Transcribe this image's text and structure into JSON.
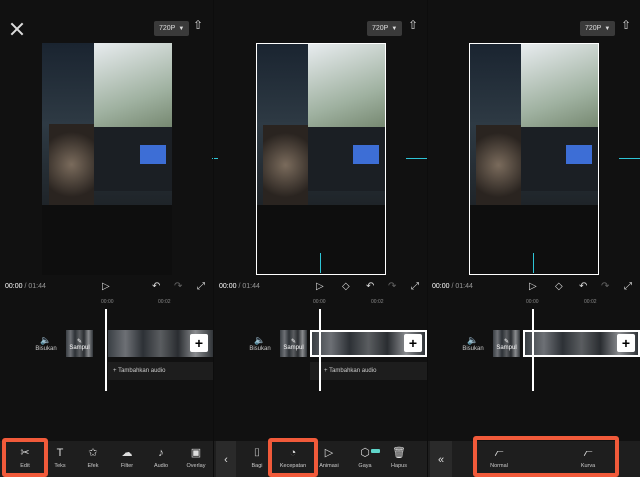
{
  "export": {
    "resolution": "720P"
  },
  "player": {
    "current": "00:00",
    "separator": " / ",
    "total": "01:44"
  },
  "ruler": {
    "t0": "00:00",
    "t1": "00:02"
  },
  "track": {
    "mute_label": "Bisukan",
    "cover_label": "Sampul",
    "add_audio": "+  Tambahkan audio"
  },
  "panel1_tools": [
    {
      "label": "Edit",
      "icon": "scissors-icon",
      "glyph": "✂"
    },
    {
      "label": "Teks",
      "icon": "text-icon",
      "glyph": "T"
    },
    {
      "label": "Efek",
      "icon": "star-effect-icon",
      "glyph": "✩"
    },
    {
      "label": "Filter",
      "icon": "filter-icon",
      "glyph": "☁"
    },
    {
      "label": "Audio",
      "icon": "music-note-icon",
      "glyph": "♪"
    },
    {
      "label": "Overlay",
      "icon": "overlay-icon",
      "glyph": "▣"
    }
  ],
  "panel2_tools": [
    {
      "label": "Bagi",
      "icon": "split-icon",
      "glyph": "⌷"
    },
    {
      "label": "Kecepatan",
      "icon": "speed-icon",
      "glyph": "◔"
    },
    {
      "label": "Animasi",
      "icon": "animation-icon",
      "glyph": "▷"
    },
    {
      "label": "Gaya",
      "icon": "style-cube-icon",
      "glyph": "⬡"
    },
    {
      "label": "Hapus",
      "icon": "delete-icon",
      "glyph": "🗑"
    }
  ],
  "panel3_tools": [
    {
      "label": "Normal",
      "icon": "normal-speed-icon",
      "glyph": "⦧"
    },
    {
      "label": "Kurva",
      "icon": "curve-speed-icon",
      "glyph": "⦧"
    }
  ],
  "colors": {
    "highlight": "#f15a3a",
    "accent": "#2ec4d6"
  }
}
